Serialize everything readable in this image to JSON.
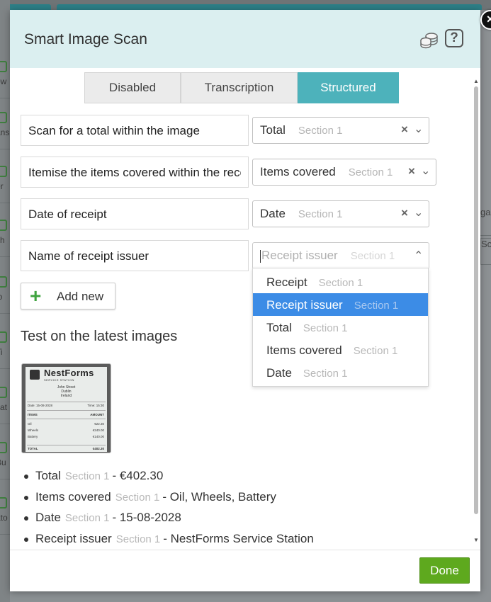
{
  "dialog": {
    "title": "Smart Image Scan",
    "help_glyph": "?",
    "close_glyph": "×",
    "icons": [
      "coins-icon",
      "help-icon",
      "close-icon"
    ]
  },
  "tabs": [
    {
      "label": "Disabled",
      "active": false
    },
    {
      "label": "Transcription",
      "active": false
    },
    {
      "label": "Structured",
      "active": true
    }
  ],
  "fields": [
    {
      "prompt": "Scan for a total within the image",
      "select": {
        "value": "Total",
        "section": "Section 1"
      }
    },
    {
      "prompt": "Itemise the items covered within the receipt",
      "select": {
        "value": "Items covered",
        "section": "Section 1"
      }
    },
    {
      "prompt": "Date of receipt",
      "select": {
        "value": "Date",
        "section": "Section 1"
      }
    },
    {
      "prompt": "Name of receipt issuer",
      "select": {
        "placeholder": "Receipt issuer",
        "section": "Section 1",
        "open": true
      }
    }
  ],
  "dropdown_options": [
    {
      "label": "Receipt",
      "section": "Section 1",
      "highlighted": false
    },
    {
      "label": "Receipt issuer",
      "section": "Section 1",
      "highlighted": true
    },
    {
      "label": "Total",
      "section": "Section 1",
      "highlighted": false
    },
    {
      "label": "Items covered",
      "section": "Section 1",
      "highlighted": false
    },
    {
      "label": "Date",
      "section": "Section 1",
      "highlighted": false
    }
  ],
  "add_new_label": "Add new",
  "test_heading": "Test on the latest images",
  "thumbnail": {
    "brand": "NestForms",
    "subtitle": "SERVICE STATION",
    "address": [
      "John Street",
      "Dublin",
      "Ireland"
    ],
    "date_label": "Date:",
    "date_value": "15-08-2028",
    "time_label": "Time:",
    "time_value": "15:30",
    "items_header": "ITEMS",
    "amount_header": "AMOUNT",
    "items": [
      {
        "name": "Oil",
        "amount": "€22.30"
      },
      {
        "name": "Wheels",
        "amount": "€240.00"
      },
      {
        "name": "Battery",
        "amount": "€140.00"
      }
    ],
    "total_label": "TOTAL",
    "total_value": "€402.30"
  },
  "results": [
    {
      "field": "Total",
      "section": "Section 1",
      "value": "- €402.30"
    },
    {
      "field": "Items covered",
      "section": "Section 1",
      "value": "- Oil, Wheels, Battery"
    },
    {
      "field": "Date",
      "section": "Section 1",
      "value": "- 15-08-2028"
    },
    {
      "field": "Receipt issuer",
      "section": "Section 1",
      "value": "- NestForms Service Station"
    }
  ],
  "done_label": "Done",
  "colors": {
    "header_bg": "#dbeff0",
    "tab_active": "#4db2bb",
    "highlight": "#3c8ce6",
    "done_button": "#5ea91e",
    "add_plus": "#3fa33f"
  },
  "background": {
    "left_labels": [
      "ow",
      "ans",
      "er",
      "ch",
      "io",
      "Ti",
      "cat",
      "Bu",
      "ato"
    ],
    "right_labels": [
      "ga",
      "Sc"
    ]
  }
}
